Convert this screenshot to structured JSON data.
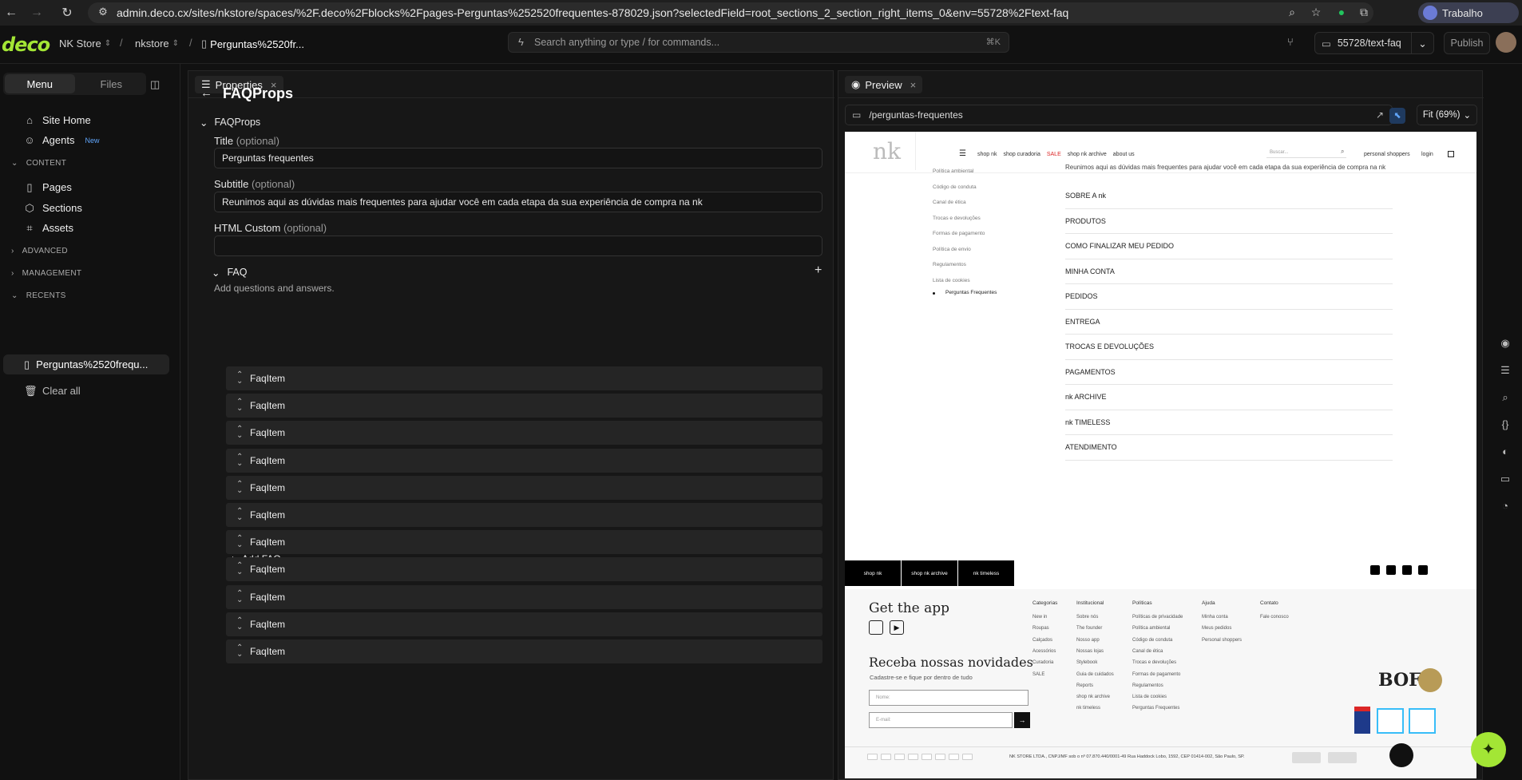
{
  "browser": {
    "url": "admin.deco.cx/sites/nkstore/spaces/%2F.deco%2Fblocks%2Fpages-Perguntas%252520frequentes-878029.json?selectedField=root_sections_2_section_right_items_0&env=55728%2Ftext-faq",
    "profile_label": "Trabalho"
  },
  "topbar": {
    "logo": "deco",
    "org": "NK Store",
    "site": "nkstore",
    "page": "Perguntas%2520fr...",
    "search_placeholder": "Search anything or type / for commands...",
    "search_shortcut": "⌘K",
    "env": "55728/text-faq",
    "publish": "Publish"
  },
  "sidebar": {
    "tabs": [
      "Menu",
      "Files"
    ],
    "top_items": [
      {
        "label": "Site Home",
        "icon": "home-icon"
      },
      {
        "label": "Agents",
        "icon": "bot-icon",
        "badge": "New"
      }
    ],
    "content_header": "CONTENT",
    "content_items": [
      {
        "label": "Pages",
        "icon": "page-icon"
      },
      {
        "label": "Sections",
        "icon": "sections-icon"
      },
      {
        "label": "Assets",
        "icon": "assets-icon"
      }
    ],
    "advanced_header": "ADVANCED",
    "management_header": "MANAGEMENT",
    "recents_header": "RECENTS",
    "recent_item": "Perguntas%2520frequ...",
    "clear_all": "Clear all"
  },
  "properties": {
    "tab": "Properties",
    "heading": "FAQProps",
    "section": "FAQProps",
    "title_label": "Title",
    "title_opt": "(optional)",
    "title_value": "Perguntas frequentes",
    "subtitle_label": "Subtitle",
    "subtitle_opt": "(optional)",
    "subtitle_value": "Reunimos aqui as dúvidas mais frequentes para ajudar você em cada etapa da sua experiência de compra na nk",
    "html_label": "HTML Custom",
    "html_opt": "(optional)",
    "html_value": "",
    "faq_label": "FAQ",
    "faq_desc": "Add questions and answers.",
    "faq_items": [
      "FaqItem",
      "FaqItem",
      "FaqItem",
      "FaqItem",
      "FaqItem",
      "FaqItem",
      "FaqItem",
      "FaqItem",
      "FaqItem",
      "FaqItem",
      "FaqItem"
    ],
    "add_faq": "Add FAQ"
  },
  "preview": {
    "tab": "Preview",
    "path": "/perguntas-frequentes",
    "zoom": "Fit (69%)",
    "site": {
      "logo": "nk",
      "nav": [
        "shop nk",
        "shop curadoria",
        "SALE",
        "shop nk archive",
        "about us"
      ],
      "search_placeholder": "Buscar...",
      "personal": "personal shoppers",
      "login": "login",
      "left_menu": [
        "Política ambiental",
        "Código de conduta",
        "Canal de ética",
        "Trocas e devoluções",
        "Formas de pagamento",
        "Política de envio",
        "Regulamentos",
        "Lista de cookies"
      ],
      "left_active": "Perguntas Frequentes",
      "intro": "Reunimos aqui as dúvidas mais frequentes para ajudar você em cada etapa da sua experiência de compra na nk",
      "faq_rows": [
        "SOBRE A nk",
        "PRODUTOS",
        "COMO FINALIZAR MEU PEDIDO",
        "MINHA CONTA",
        "PEDIDOS",
        "ENTREGA",
        "TROCAS E DEVOLUÇÕES",
        "PAGAMENTOS",
        "nk ARCHIVE",
        "nk TIMELESS",
        "ATENDIMENTO"
      ],
      "footer_blocks": [
        "shop nk",
        "shop nk archive",
        "nk timeless"
      ],
      "get_app": "Get the app",
      "newsletter": "Receba nossas novidades",
      "newsletter_sub": "Cadastre-se e fique por dentro de tudo",
      "name_ph": "Nome:",
      "email_ph": "E-mail:",
      "cols": [
        {
          "h": "Categorias",
          "items": [
            "New in",
            "Roupas",
            "Calçados",
            "Acessórios",
            "Curadoria",
            "SALE"
          ]
        },
        {
          "h": "Institucional",
          "items": [
            "Sobre nós",
            "The founder",
            "Nosso app",
            "Nossas lojas",
            "Stylebook",
            "Guia de cuidados",
            "Reports",
            "shop nk archive",
            "nk timeless"
          ]
        },
        {
          "h": "Políticas",
          "items": [
            "Políticas de privacidade",
            "Política ambiental",
            "Código de conduta",
            "Canal de ética",
            "Trocas e devoluções",
            "Formas de pagamento",
            "Regulamentos",
            "Lista de cookies",
            "Perguntas Frequentes"
          ]
        },
        {
          "h": "Ajuda",
          "items": [
            "Minha conta",
            "Meus pedidos",
            "Personal shoppers"
          ]
        },
        {
          "h": "Contato",
          "items": [
            "Fale conosco"
          ]
        }
      ],
      "bof": "BOF",
      "legal": "NK STORE LTDA., CNPJ/MF sob o nº 07.870.440/0001-49 Rua Haddock Lobo, 1592, CEP 01414-002, São Paulo, SP."
    }
  }
}
